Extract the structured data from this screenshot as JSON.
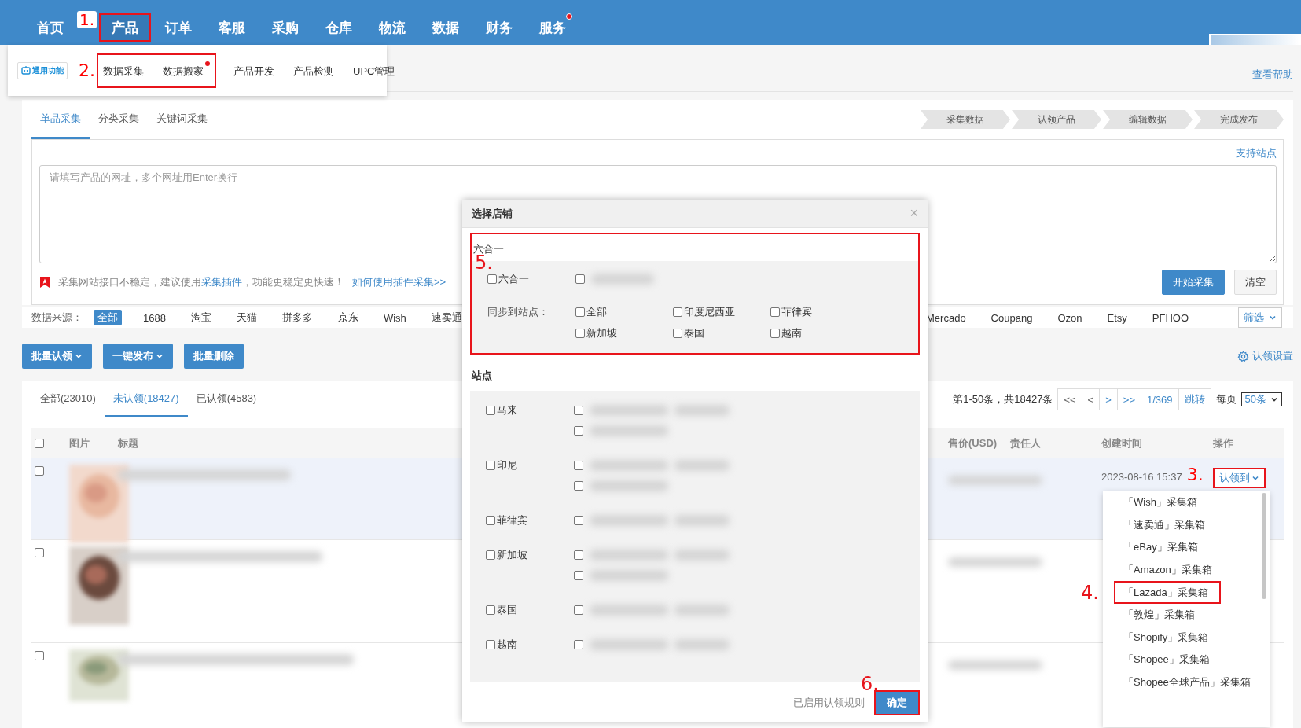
{
  "nav": {
    "items": [
      {
        "label": "首页",
        "selected": false
      },
      {
        "label": "产品",
        "selected": true,
        "annotation": "1."
      },
      {
        "label": "订单",
        "selected": false
      },
      {
        "label": "客服",
        "selected": false
      },
      {
        "label": "采购",
        "selected": false
      },
      {
        "label": "仓库",
        "selected": false
      },
      {
        "label": "物流",
        "selected": false
      },
      {
        "label": "数据",
        "selected": false
      },
      {
        "label": "财务",
        "selected": false
      },
      {
        "label": "服务",
        "selected": false,
        "dot": true
      }
    ]
  },
  "submenu": {
    "badge": "通用功能",
    "groups": [
      {
        "annotation": "2.",
        "items": [
          {
            "label": "数据采集",
            "dot": false
          },
          {
            "label": "数据搬家",
            "dot": true
          }
        ]
      },
      {
        "items": [
          {
            "label": "产品开发",
            "dot": false
          },
          {
            "label": "产品检测",
            "dot": false
          },
          {
            "label": "UPC管理",
            "dot": false
          }
        ]
      }
    ]
  },
  "help_link": "查看帮助",
  "collect": {
    "tabs": [
      {
        "label": "单品采集",
        "selected": true
      },
      {
        "label": "分类采集",
        "selected": false
      },
      {
        "label": "关键词采集",
        "selected": false
      }
    ],
    "steps": [
      "采集数据",
      "认领产品",
      "编辑数据",
      "完成发布"
    ],
    "support_link": "支持站点",
    "placeholder": "请填写产品的网址，多个网址用Enter换行",
    "notice": {
      "before": "采集网站接口不稳定，建议使用",
      "link": "采集插件",
      "after": "，功能更稳定更快速！"
    },
    "guide_link": "如何使用插件采集>>",
    "buttons": [
      {
        "label": "开始采集",
        "kind": "primary"
      },
      {
        "label": "清空",
        "kind": "default"
      }
    ]
  },
  "sources": {
    "label": "数据来源：",
    "left_items": [
      {
        "label": "全部",
        "selected": true
      },
      {
        "label": "1688",
        "selected": false
      },
      {
        "label": "淘宝",
        "selected": false
      },
      {
        "label": "天猫",
        "selected": false
      },
      {
        "label": "拼多多",
        "selected": false
      },
      {
        "label": "京东",
        "selected": false
      },
      {
        "label": "Wish",
        "selected": false
      },
      {
        "label": "速卖通",
        "selected": false
      }
    ],
    "right_items": [
      {
        "label": "Mercado",
        "selected": false
      },
      {
        "label": "Coupang",
        "selected": false
      },
      {
        "label": "Ozon",
        "selected": false
      },
      {
        "label": "Etsy",
        "selected": false
      },
      {
        "label": "PFHOO",
        "selected": false
      }
    ],
    "filter": "筛选"
  },
  "bulk_buttons": [
    {
      "label": "批量认领",
      "caret": true
    },
    {
      "label": "一键发布",
      "caret": true
    },
    {
      "label": "批量删除",
      "caret": false
    }
  ],
  "claim_settings": "认领设置",
  "list": {
    "tabs": [
      {
        "label": "全部(23010)",
        "selected": false
      },
      {
        "label": "未认领(18427)",
        "selected": true
      },
      {
        "label": "已认领(4583)",
        "selected": false
      }
    ],
    "range": "第1-50条，共18427条",
    "pager": [
      {
        "label": "<<",
        "disabled": true
      },
      {
        "label": "<",
        "disabled": true
      },
      {
        "label": ">",
        "disabled": false
      },
      {
        "label": ">>",
        "disabled": false
      },
      {
        "label": "1/369",
        "disabled": false
      },
      {
        "label": "跳转",
        "disabled": false
      }
    ],
    "per_page_label": "每页",
    "per_page": "50条",
    "select_all": {
      "checked": false
    },
    "columns": [
      "图片",
      "标题",
      "售价(USD)",
      "责任人",
      "创建时间",
      "操作"
    ],
    "rows": [
      {
        "checked": false,
        "highlighted": true,
        "created": "2023-08-16 15:37",
        "action": "认领到",
        "action_annotation": "3."
      },
      {
        "checked": false,
        "highlighted": false
      },
      {
        "checked": false,
        "highlighted": false
      }
    ]
  },
  "claim_menu": {
    "items": [
      {
        "label": "「Wish」采集箱"
      },
      {
        "label": "「速卖通」采集箱"
      },
      {
        "label": "「eBay」采集箱"
      },
      {
        "label": "「Amazon」采集箱"
      },
      {
        "label": "「Lazada」采集箱",
        "annotation": "4."
      },
      {
        "label": "「敦煌」采集箱"
      },
      {
        "label": "「Shopify」采集箱"
      },
      {
        "label": "「Shopee」采集箱"
      },
      {
        "label": "「Shopee全球产品」采集箱"
      }
    ]
  },
  "modal": {
    "title": "选择店铺",
    "close": "×",
    "combo": {
      "title": "六合一",
      "annotation": "5.",
      "option": {
        "label": "六合一",
        "checked": false
      },
      "stores": [
        {
          "checked": false
        }
      ],
      "sync_label": "同步到站点：",
      "sync_sites": [
        {
          "label": "全部",
          "checked": false
        },
        {
          "label": "印度尼西亚",
          "checked": false
        },
        {
          "label": "菲律宾",
          "checked": false
        },
        {
          "label": "新加坡",
          "checked": false
        },
        {
          "label": "泰国",
          "checked": false
        },
        {
          "label": "越南",
          "checked": false
        }
      ]
    },
    "sites_title": "站点",
    "sites": [
      {
        "label": "马来",
        "checked": false,
        "stores": [
          {
            "checked": false
          },
          {
            "checked": false
          }
        ]
      },
      {
        "label": "印尼",
        "checked": false,
        "stores": [
          {
            "checked": false
          },
          {
            "checked": false
          }
        ]
      },
      {
        "label": "菲律宾",
        "checked": false,
        "stores": [
          {
            "checked": false
          }
        ]
      },
      {
        "label": "新加坡",
        "checked": false,
        "stores": [
          {
            "checked": false
          },
          {
            "checked": false
          }
        ]
      },
      {
        "label": "泰国",
        "checked": false,
        "stores": [
          {
            "checked": false
          }
        ]
      },
      {
        "label": "越南",
        "checked": false,
        "stores": [
          {
            "checked": false
          }
        ]
      }
    ],
    "rules_note": "已启用认领规则",
    "confirm": {
      "label": "确定",
      "annotation": "6."
    }
  }
}
